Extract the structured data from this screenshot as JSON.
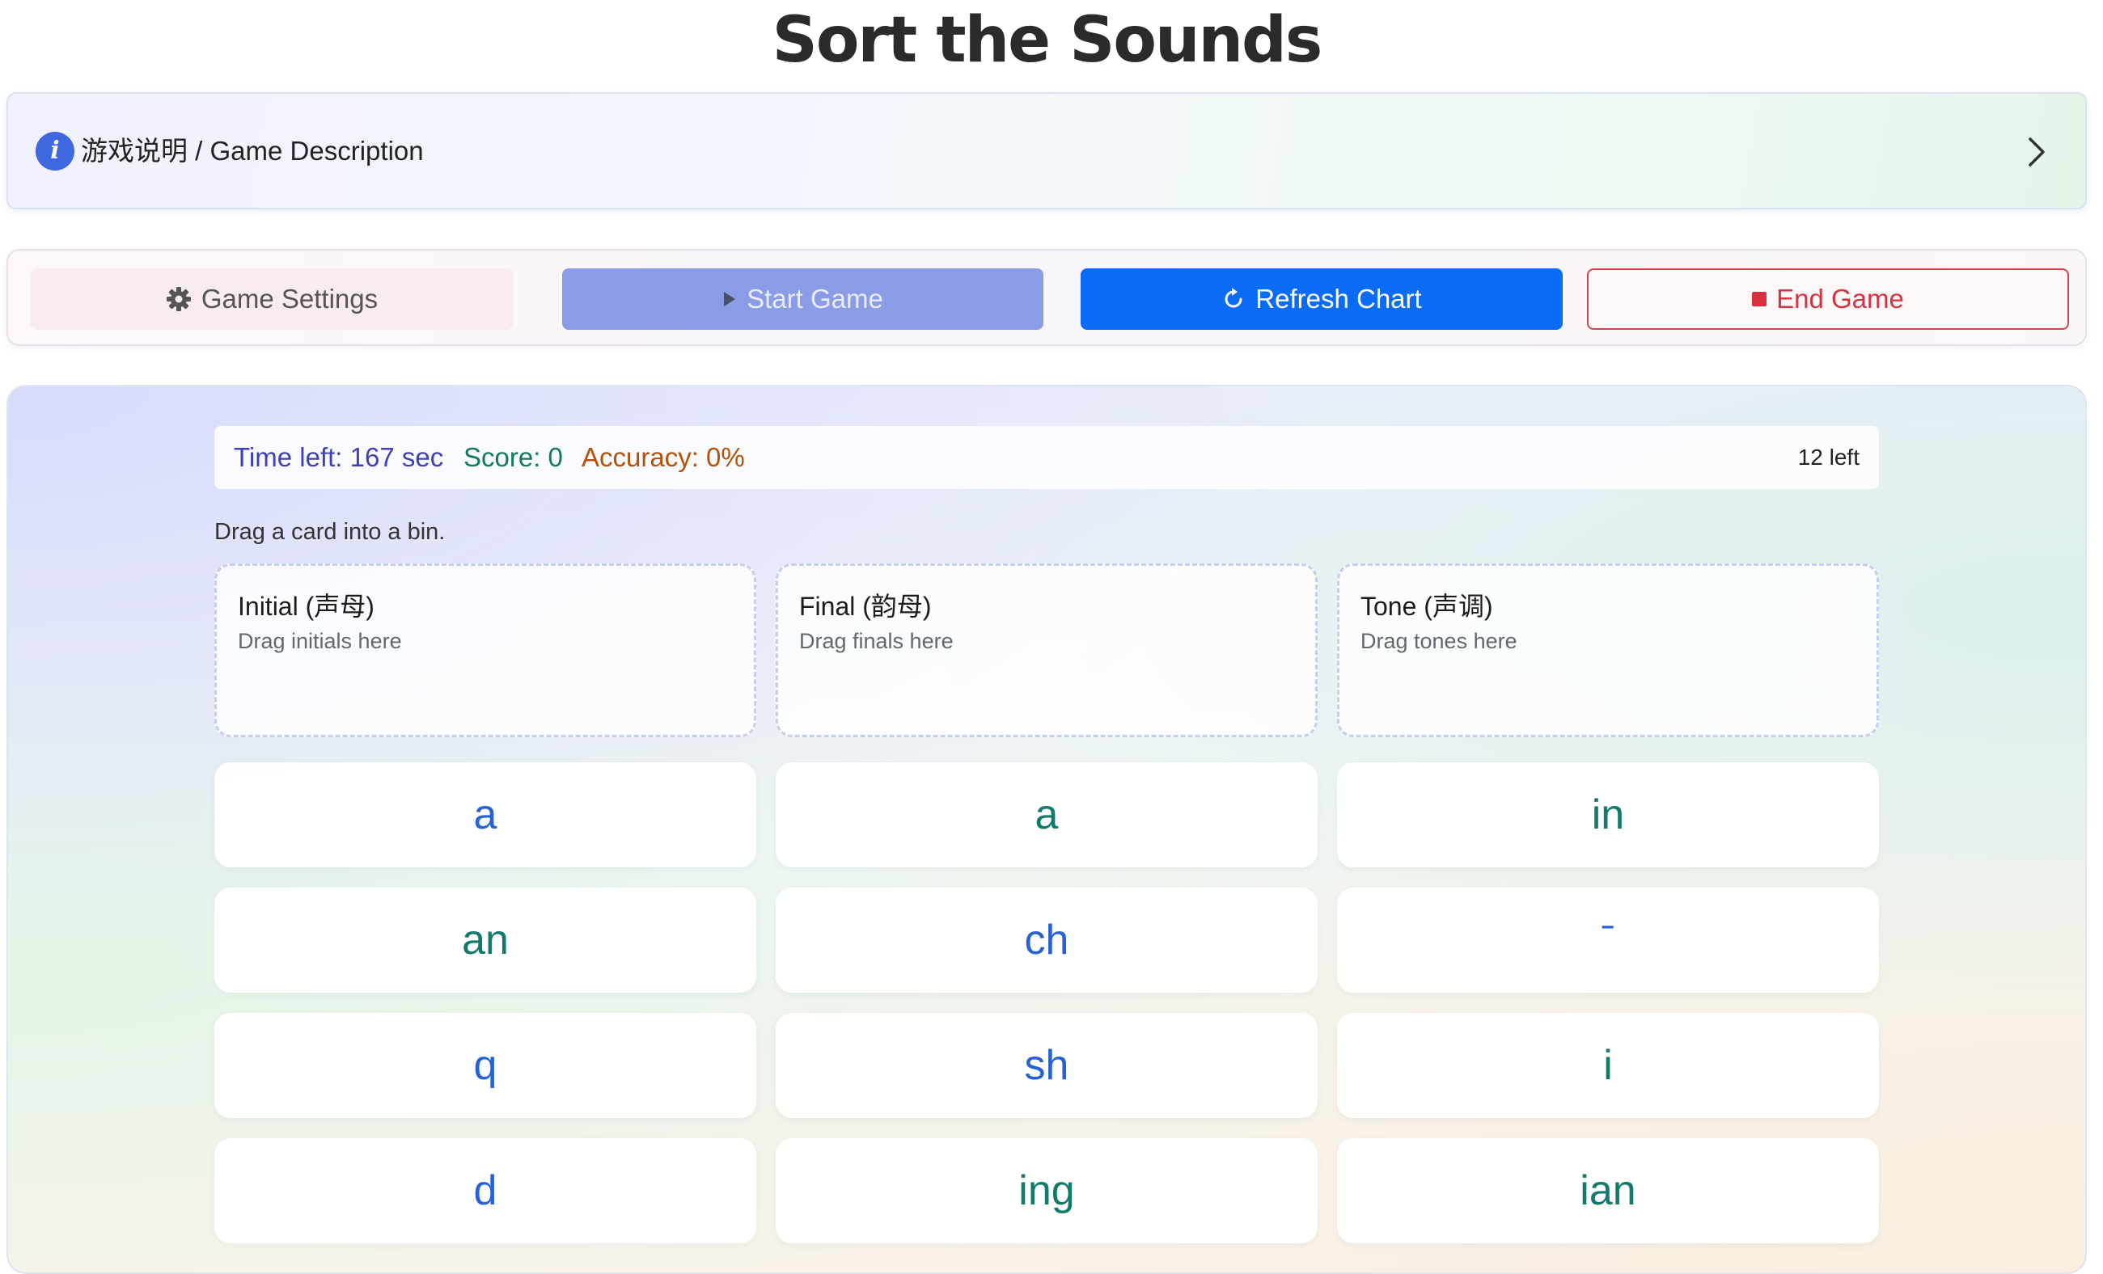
{
  "header": {
    "title": "Sort the Sounds"
  },
  "description_bar": {
    "icon": "info-icon",
    "label": "游戏说明 / Game Description",
    "chevron": "chevron-right-icon"
  },
  "toolbar": {
    "settings_label": "Game Settings",
    "settings_icon": "gear-icon",
    "start_label": "Start Game",
    "start_icon": "play-icon",
    "refresh_label": "Refresh Chart",
    "refresh_icon": "refresh-icon",
    "end_label": "End Game",
    "end_icon": "stop-icon"
  },
  "stats": {
    "time": "Time left: 167 sec",
    "score": "Score: 0",
    "accuracy": "Accuracy: 0%",
    "remaining": "12 left"
  },
  "instruction": "Drag a card into a bin.",
  "bins": [
    {
      "title": "Initial (声母)",
      "hint": "Drag initials here"
    },
    {
      "title": "Final (韵母)",
      "hint": "Drag finals here"
    },
    {
      "title": "Tone (声调)",
      "hint": "Drag tones here"
    }
  ],
  "cards": [
    {
      "text": "a",
      "color": "#2861d4"
    },
    {
      "text": "a",
      "color": "#127a6a"
    },
    {
      "text": "in",
      "color": "#127a6a"
    },
    {
      "text": "an",
      "color": "#127a6a"
    },
    {
      "text": "ch",
      "color": "#2861d4"
    },
    {
      "text": "ˉ",
      "color": "#2861d4"
    },
    {
      "text": "q",
      "color": "#2861d4"
    },
    {
      "text": "sh",
      "color": "#2861d4"
    },
    {
      "text": "i",
      "color": "#127a6a"
    },
    {
      "text": "d",
      "color": "#2861d4"
    },
    {
      "text": "ing",
      "color": "#127a6a"
    },
    {
      "text": "ian",
      "color": "#127a6a"
    }
  ],
  "colors": {
    "primary_blue": "#0a6cf5",
    "start_disabled": "#8a9ce6",
    "end_red": "#d13442",
    "info_icon": "#3f68e0"
  }
}
